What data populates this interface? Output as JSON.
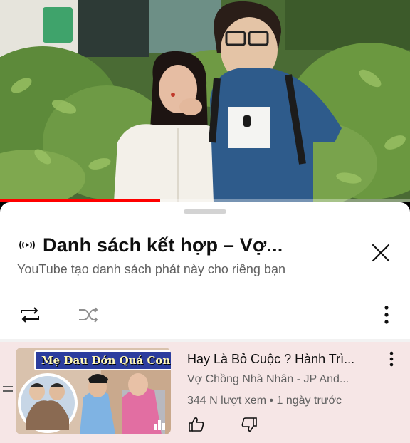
{
  "video": {
    "progress_fraction": 0.39
  },
  "playlist": {
    "title": "Danh sách kết hợp – Vợ...",
    "subtitle": "YouTube tạo danh sách phát này cho riêng bạn"
  },
  "icons": {
    "mix": "mix-broadcast-icon",
    "close": "close-icon",
    "loop": "loop-icon",
    "shuffle": "shuffle-icon",
    "more": "more-vertical-icon",
    "drag": "drag-handle-icon",
    "like": "thumbs-up-icon",
    "dislike": "thumbs-down-icon",
    "now_playing": "now-playing-bars-icon"
  },
  "item": {
    "thumbnail_banner": "Mẹ Đau Đớn Quá Con Ơi !",
    "title": "Hay Là Bỏ Cuộc ? Hành Trì...",
    "channel": "Vợ Chồng Nhà Nhân - JP And...",
    "meta": "344 N lượt xem • 1 ngày trước"
  },
  "colors": {
    "progress": "#ff0000",
    "item_highlight": "#f6e6e6",
    "thumb_banner_bg": "#2b3d9e"
  }
}
